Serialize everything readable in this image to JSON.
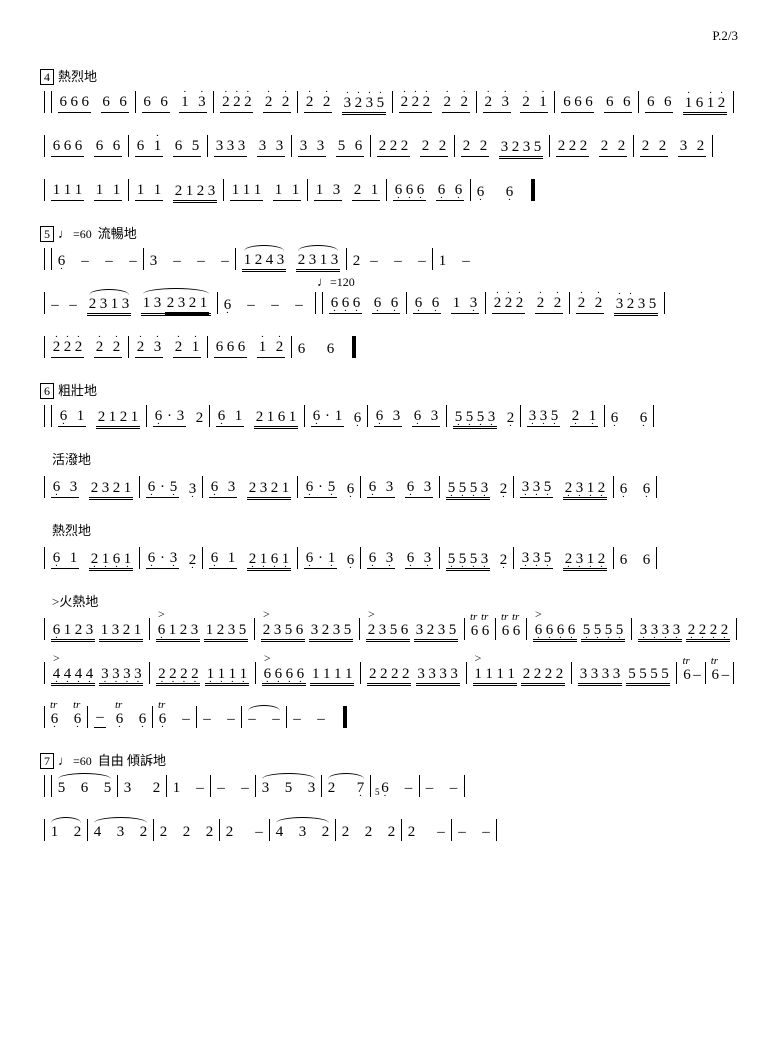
{
  "page_number": "P.2/3",
  "sections": {
    "s4": {
      "number": "4",
      "expression": "熱烈地"
    },
    "s5": {
      "number": "5",
      "tempo": "=60",
      "expression": "流暢地",
      "tempo2": "=120"
    },
    "s6": {
      "number": "6",
      "expression": "粗壯地",
      "expr_b": "活潑地",
      "expr_c": "熱烈地",
      "expr_d": "火熱地"
    },
    "s7": {
      "number": "7",
      "tempo": "=60",
      "expression": "自由  傾訴地"
    }
  },
  "rows": [
    {
      "id": "r1",
      "bars": [
        "666 66",
        "6 6 1̇ 3̇",
        "2̇2̇2̇ 2̇ 2̇",
        "2̇ 2̇ 3̇2̇3̇5̇",
        "2̇2̇2̇ 2̇ 2̇",
        "2̇ 3̇ 2̇ 1̇",
        "666 66",
        "6 6 1̇61̇2̇"
      ]
    },
    {
      "id": "r2",
      "bars": [
        "666 66",
        "6 1̇ 6 5",
        "333 3 3",
        "3 3 5 6",
        "222 2 2",
        "2 2 3235",
        "222 2 2",
        "2 2 3 2"
      ]
    },
    {
      "id": "r3",
      "bars": [
        "111 1 1",
        "1 1 2123",
        "111 1 1",
        "1 3 2 1",
        "6̣6̣6̣ 6̣ 6̣",
        "6̣   6̣",
        "‖"
      ]
    },
    {
      "id": "r4",
      "bars": [
        "6̣  –  –  –",
        "3  –  –  –",
        "1243 2313",
        "2 – – –",
        "1  –"
      ]
    },
    {
      "id": "r5",
      "bars": [
        "– – 2313 132321",
        "6̣  –  –  –",
        "‖ 6̣6̣6̣ 6̣ 6̣",
        "6̣ 6̣ 1 3̣",
        "2̇2̇2̇ 2̇ 2̇",
        "2̇ 2̇ 3̇2̇35"
      ]
    },
    {
      "id": "r6",
      "bars": [
        "2̇2̇2̇ 2̇ 2̇",
        "2̇ 3̇ 2̇ 1̇",
        "666 1̇ 2̇",
        "6   6",
        "‖"
      ]
    },
    {
      "id": "r7",
      "bars": [
        "6̣ 1 2121",
        "6̣·3 2",
        "6̣ 1 2161",
        "6̣·1 6̣",
        "6̣ 3 6̣ 3",
        "5̣5̣5̣3̣ 2̣",
        "3̣3̣5̣ 2̣ 1̣",
        "6̣   6̣"
      ]
    },
    {
      "id": "r8",
      "bars": [
        "6̣ 3 2321",
        "6̣·5̣ 3̣",
        "6̣ 3 2321",
        "6̣·5̣ 6̣",
        "6̣ 3 6̣ 3",
        "5̣5̣5̣3̣ 2̣",
        "3̣3̣5̣ 2̣3̣1̣2̣",
        "6̣  6̣"
      ]
    },
    {
      "id": "r9",
      "bars": [
        "6̣ 1 2̣1̣6̣1̣",
        "6̣·3̣ 2̣",
        "6̣ 1 2̣1̣6̣1̣",
        "6̣·1̣ 6̣",
        "6̣ 3̣ 6̣ 3̣",
        "5̣5̣5̣3̣ 2̣",
        "3̣3̣5̣ 2̣3̣1̣2̣",
        "6  6"
      ]
    },
    {
      "id": "r10",
      "bars": [
        "6̣123 1321",
        "6̣123 1235",
        "2356 3235",
        "2356 3235",
        "tr6 tr6",
        "tr6 tr6",
        "6̣6̣6̣6̣ 5̣5̣5̣5̣",
        "3̣3̣3̣3̣ 2̣2̣2̣2̣"
      ]
    },
    {
      "id": "r11",
      "bars": [
        "4̣4̣4̣4̣ 3̣3̣3̣3̣",
        "2̣2̣2̣2̣ 1̣1̣1̣1̣",
        "6̣6̣6̣6̣ 1111",
        "2222 3333",
        "1111 2222",
        "3333 5555",
        "tr6  –",
        "tr6  –"
      ]
    },
    {
      "id": "r12",
      "bars": [
        "tr6̣  tr6̣",
        "–  tr6̣  6̣",
        "tr6̣  –",
        "–  –",
        "–  –",
        "–  –",
        "‖"
      ]
    },
    {
      "id": "r13",
      "bars": [
        "5  6  5",
        "3   2",
        "1  –",
        "–  –",
        "3  5  3",
        "2   7̣",
        "⁵6̣  –",
        "–  –"
      ]
    },
    {
      "id": "r14",
      "bars": [
        "1  2",
        "4  3  2",
        "2  2  2",
        "2   –",
        "4  3  2",
        "2  2  2",
        "2   –",
        "–  –"
      ]
    }
  ]
}
